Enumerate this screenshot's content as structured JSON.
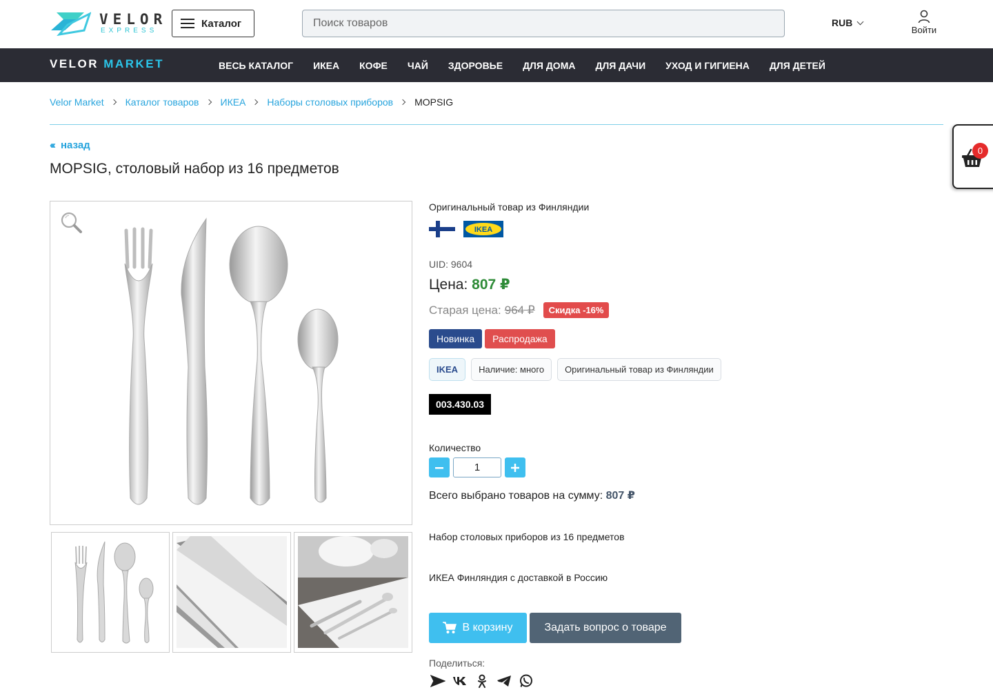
{
  "header": {
    "logo_main": "VELOR",
    "logo_sub": "EXPRESS",
    "catalog_button": "Каталог",
    "search_placeholder": "Поиск товаров",
    "currency": "RUB",
    "login": "Войти"
  },
  "navbar": {
    "brand_part1": "VELOR",
    "brand_part2": "MARKET",
    "items": [
      "ВЕСЬ КАТАЛОГ",
      "ИКЕА",
      "КОФЕ",
      "ЧАЙ",
      "ЗДОРОВЬЕ",
      "ДЛЯ ДОМА",
      "ДЛЯ ДАЧИ",
      "УХОД И ГИГИЕНА",
      "ДЛЯ ДЕТЕЙ"
    ]
  },
  "breadcrumb": [
    "Velor Market",
    "Каталог товаров",
    "ИКЕА",
    "Наборы столовых приборов",
    "MOPSIG"
  ],
  "back_label": "назад",
  "product": {
    "title": "MOPSIG, столовый набор из 16 предметов",
    "origin": "Оригинальный товар из Финляндии",
    "brand_logo": "IKEA",
    "uid": "UID: 9604",
    "price_label": "Цена:",
    "price_value": "807 ₽",
    "old_price_label": "Старая цена:",
    "old_price_value": "964 ₽",
    "discount": "Скидка -16%",
    "badges": [
      "Новинка",
      "Распродажа"
    ],
    "chips": [
      "IKEA",
      "Наличие: много",
      "Оригинальный товар из Финляндии"
    ],
    "sku": "003.430.03",
    "quantity_label": "Количество",
    "quantity_value": "1",
    "total_label": "Всего выбрано товаров на сумму:",
    "total_value": "807 ₽",
    "description_1": "Набор столовых приборов из 16 предметов",
    "description_2": "ИКЕА Финляндия с доставкой в Россию",
    "add_to_cart": "В корзину",
    "ask_question": "Задать вопрос о товаре",
    "share_label": "Поделиться:"
  },
  "cart": {
    "count": "0"
  },
  "colors": {
    "accent": "#3fbfef",
    "link": "#27a4dd",
    "navbar": "#2b2c34",
    "price": "#2e8b37",
    "discount": "#e24b4b",
    "badge_new": "#2a4b8d",
    "ask_button": "#516475"
  },
  "icons": {
    "share": [
      "send-icon",
      "vk-icon",
      "odnoklassniki-icon",
      "telegram-icon",
      "whatsapp-icon"
    ]
  }
}
